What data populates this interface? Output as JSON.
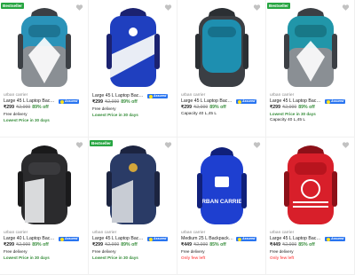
{
  "products": [
    {
      "badge": "Bestseller",
      "brand": "urban carrier",
      "title": "Large 45 L Laptop Backpack ...",
      "assured": "Assured",
      "price": "₹299",
      "mrp": "₹2,999",
      "discount": "89% off",
      "delivery": "Free delivery",
      "note": "Lowest Price in 30 days",
      "colors": {
        "main": "#2a93b9",
        "accent": "#8a8f94",
        "strap": "#3b3f44"
      }
    },
    {
      "badge": "",
      "brand": "",
      "title": "Large 45 L Laptop Backpack ...",
      "assured": "Assured",
      "price": "₹299",
      "mrp": "₹2,999",
      "discount": "89% off",
      "delivery": "Free delivery",
      "note": "Lowest Price in 30 days",
      "colors": {
        "main": "#1f3fbf",
        "accent": "#e9edf5",
        "strap": "#1b2270"
      }
    },
    {
      "badge": "",
      "brand": "urban carrier",
      "title": "Large 45 L Laptop Backpack ...",
      "assured": "Assured",
      "price": "₹299",
      "mrp": "₹2,999",
      "discount": "89% off",
      "delivery": "",
      "note": "",
      "capacity": "Capacity 40 L,45 L",
      "colors": {
        "main": "#1e8fb0",
        "accent": "#3b3f44",
        "strap": "#2b2f33"
      }
    },
    {
      "badge": "Bestseller",
      "brand": "urban carrier",
      "title": "Large 45 L Laptop Backpack ...",
      "assured": "Assured",
      "price": "₹299",
      "mrp": "₹2,999",
      "discount": "89% off",
      "delivery": "",
      "note": "Lowest Price in 30 days",
      "capacity": "Capacity 40 L,45 L",
      "colors": {
        "main": "#2196a9",
        "accent": "#8a8f94",
        "strap": "#3b3f44"
      }
    },
    {
      "badge": "",
      "brand": "urban carrier",
      "title": "Large 40 L Laptop Backpack ...",
      "assured": "Assured",
      "price": "₹299",
      "mrp": "₹2,999",
      "discount": "89% off",
      "delivery": "Free delivery",
      "note": "Lowest Price in 30 days",
      "colors": {
        "main": "#2b2b2d",
        "accent": "#d9dadc",
        "strap": "#1a1a1b"
      }
    },
    {
      "badge": "Bestseller",
      "brand": "urban carrier",
      "title": "Large 45 L Laptop Backpack ...",
      "assured": "Assured",
      "price": "₹299",
      "mrp": "₹2,999",
      "discount": "89% off",
      "delivery": "Free delivery",
      "note": "Lowest Price in 30 days",
      "colors": {
        "main": "#2a3b66",
        "accent": "#c8ccd4",
        "strap": "#1c2440"
      }
    },
    {
      "badge": "",
      "brand": "urban carrier",
      "title": "Medium 25 L Backpack Medi...",
      "assured": "Assured",
      "price": "₹449",
      "mrp": "₹2,999",
      "discount": "85% off",
      "delivery": "Free delivery",
      "note": "Only few left",
      "note_style": "red",
      "bag_text": "URBAN CARRIER",
      "colors": {
        "main": "#1e3fd0",
        "accent": "#ffffff",
        "strap": "#10207a"
      }
    },
    {
      "badge": "",
      "brand": "urban carrier",
      "title": "Large 45 L Laptop Backpack ...",
      "assured": "Assured",
      "price": "₹449",
      "mrp": "₹2,999",
      "discount": "85% off",
      "delivery": "Free delivery",
      "note": "Only few left",
      "note_style": "red",
      "colors": {
        "main": "#d81f2a",
        "accent": "#ffffff",
        "strap": "#8c1018"
      }
    }
  ]
}
